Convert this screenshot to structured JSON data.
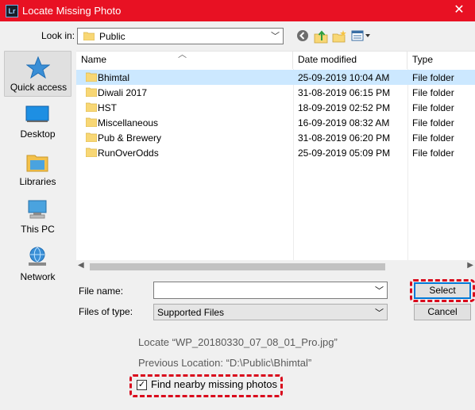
{
  "window": {
    "title": "Locate Missing Photo",
    "app_icon": "Lr",
    "close_glyph": "✕"
  },
  "toolbar": {
    "lookin_label": "Look in:",
    "lookin_value": "Public",
    "buttons": [
      "back-icon",
      "up-folder-icon",
      "new-folder-icon",
      "view-menu-icon"
    ]
  },
  "places": [
    {
      "label": "Quick access",
      "icon": "star-icon"
    },
    {
      "label": "Desktop",
      "icon": "desktop-icon"
    },
    {
      "label": "Libraries",
      "icon": "libraries-icon"
    },
    {
      "label": "This PC",
      "icon": "computer-icon"
    },
    {
      "label": "Network",
      "icon": "network-icon"
    }
  ],
  "columns": {
    "name": "Name",
    "date": "Date modified",
    "type": "Type"
  },
  "files": [
    {
      "name": "Bhimtal",
      "date": "25-09-2019 10:04 AM",
      "type": "File folder",
      "selected": true
    },
    {
      "name": "Diwali 2017",
      "date": "31-08-2019 06:15 PM",
      "type": "File folder"
    },
    {
      "name": "HST",
      "date": "18-09-2019 02:52 PM",
      "type": "File folder"
    },
    {
      "name": "Miscellaneous",
      "date": "16-09-2019 08:32 AM",
      "type": "File folder"
    },
    {
      "name": "Pub & Brewery",
      "date": "31-08-2019 06:20 PM",
      "type": "File folder"
    },
    {
      "name": "RunOverOdds",
      "date": "25-09-2019 05:09 PM",
      "type": "File folder"
    }
  ],
  "form": {
    "filename_label": "File name:",
    "filename_value": "",
    "filetype_label": "Files of type:",
    "filetype_value": "Supported Files",
    "select_label": "Select",
    "cancel_label": "Cancel"
  },
  "info": {
    "locate": "Locate “WP_20180330_07_08_01_Pro.jpg”",
    "previous": "Previous Location: “D:\\Public\\Bhimtal”"
  },
  "option": {
    "label": "Find nearby missing photos",
    "checked": true
  },
  "colors": {
    "titlebar": "#e81123",
    "selection": "#cce8ff",
    "highlight": "#d9091c",
    "accent": "#0078d7"
  }
}
